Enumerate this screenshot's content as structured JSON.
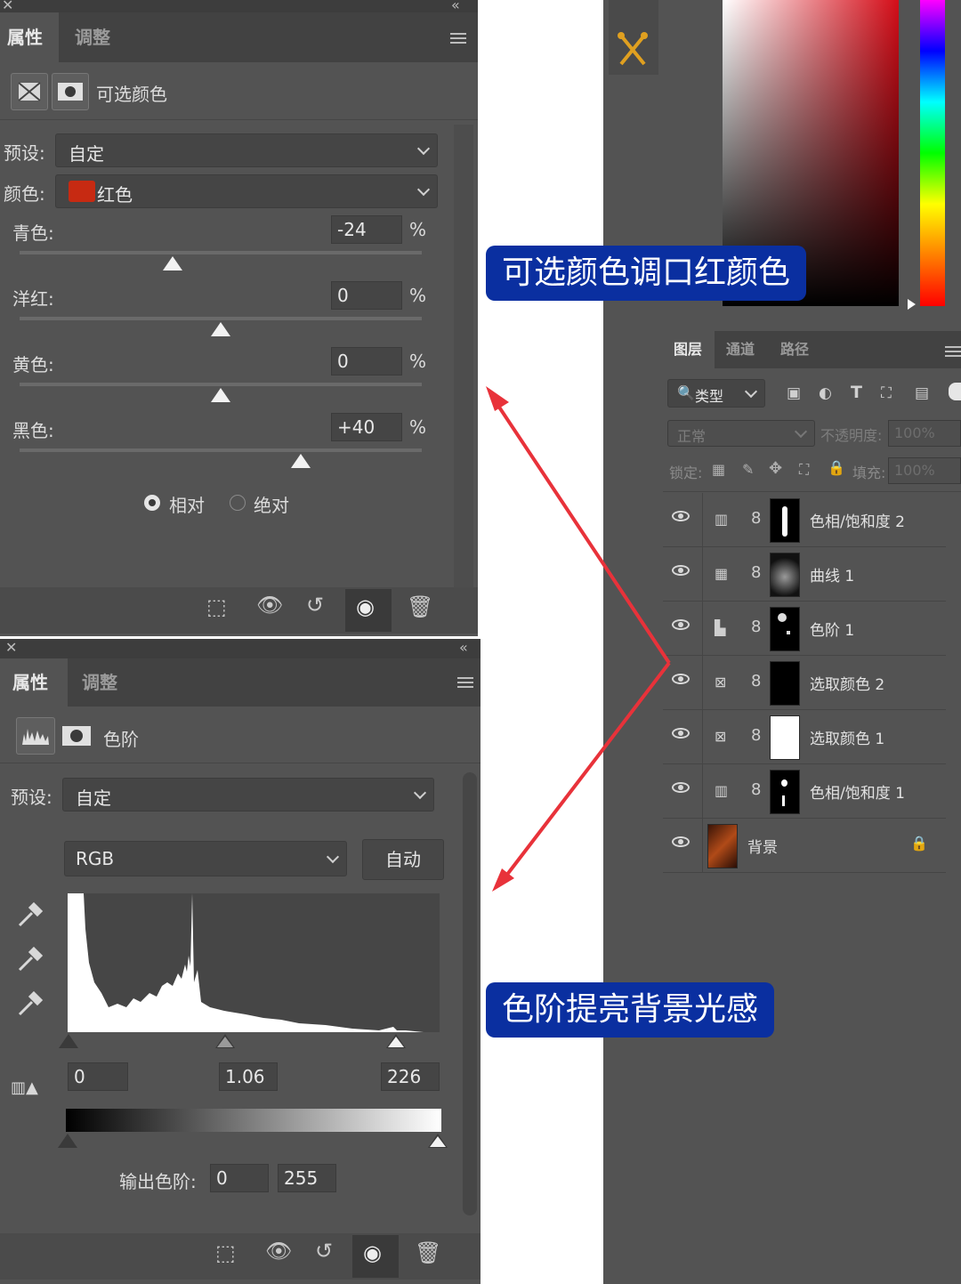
{
  "top_panel": {
    "tabs": [
      "属性",
      "调整"
    ],
    "title": "可选颜色",
    "preset_label": "预设:",
    "preset_value": "自定",
    "color_label": "颜色:",
    "color_value": "红色",
    "color_swatch": "#c72a12",
    "sliders": [
      {
        "label": "青色:",
        "value": "-24",
        "unit": "%",
        "level": 0.38
      },
      {
        "label": "洋红:",
        "value": "0",
        "unit": "%",
        "level": 0.5
      },
      {
        "label": "黄色:",
        "value": "0",
        "unit": "%",
        "level": 0.5
      },
      {
        "label": "黑色:",
        "value": "+40",
        "unit": "%",
        "level": 0.7
      }
    ],
    "method_options": [
      "相对",
      "绝对"
    ],
    "method_selected": "相对"
  },
  "bottom_panel": {
    "tabs": [
      "属性",
      "调整"
    ],
    "title": "色阶",
    "preset_label": "预设:",
    "preset_value": "自定",
    "channel_value": "RGB",
    "auto_button": "自动",
    "input_black": "0",
    "input_gamma": "1.06",
    "input_white": "226",
    "output_label": "输出色阶:",
    "output_black": "0",
    "output_white": "255"
  },
  "layers_panel": {
    "tabs": [
      "图层",
      "通道",
      "路径"
    ],
    "filter_label": "类型",
    "blend_mode": "正常",
    "opacity_label": "不透明度:",
    "opacity_value": "100%",
    "lock_label": "锁定:",
    "fill_label": "填充:",
    "fill_value": "100%",
    "layers": [
      {
        "name": "色相/饱和度 2",
        "type_icon": "hue-saturation-icon",
        "mask": "dark-figure"
      },
      {
        "name": "曲线 1",
        "type_icon": "curves-icon",
        "mask": "blurry"
      },
      {
        "name": "色阶 1",
        "type_icon": "levels-icon",
        "mask": "dark-spots"
      },
      {
        "name": "选取颜色 2",
        "type_icon": "selective-color-icon",
        "mask": "black"
      },
      {
        "name": "选取颜色 1",
        "type_icon": "selective-color-icon",
        "mask": "white"
      },
      {
        "name": "色相/饱和度 1",
        "type_icon": "hue-saturation-icon",
        "mask": "dark-figure"
      },
      {
        "name": "背景",
        "type_icon": "photo-thumbnail",
        "mask": "photo"
      }
    ]
  },
  "annotations": {
    "chip1": "可选颜色调口红颜色",
    "chip2": "色阶提亮背景光感",
    "arrow_color": "#e8323a",
    "chip_color": "#0a2fa0"
  }
}
